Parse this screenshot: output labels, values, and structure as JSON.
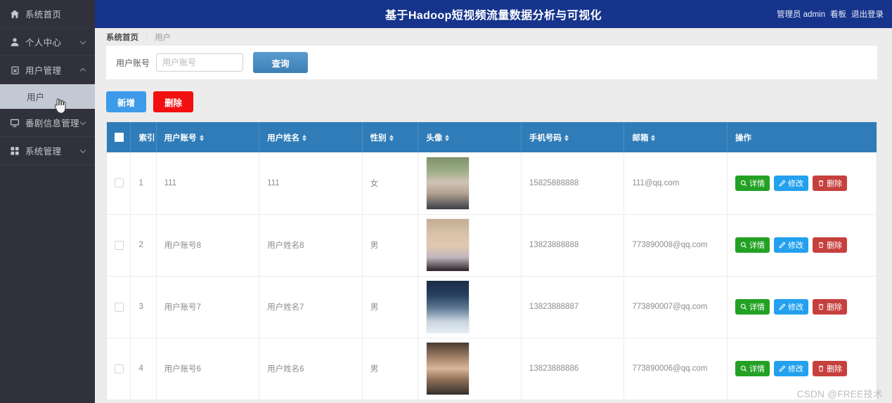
{
  "header": {
    "title": "基于Hadoop短视频流量数据分析与可视化",
    "admin_label": "管理员 admin",
    "board_label": "看板",
    "logout_label": "退出登录"
  },
  "sidebar": {
    "items": [
      {
        "label": "系统首页",
        "icon": "home-icon",
        "chevron": "none"
      },
      {
        "label": "个人中心",
        "icon": "user-icon",
        "chevron": "down"
      },
      {
        "label": "用户管理",
        "icon": "clipboard-icon",
        "chevron": "up"
      },
      {
        "label": "番剧信息管理",
        "icon": "monitor-icon",
        "chevron": "down"
      },
      {
        "label": "系统管理",
        "icon": "grid-icon",
        "chevron": "down"
      }
    ],
    "submenu": {
      "label": "用户"
    }
  },
  "breadcrumb": {
    "first": "系统首页",
    "separator": "⋮",
    "last": "用户"
  },
  "search": {
    "label": "用户账号",
    "placeholder": "用户账号",
    "value": "",
    "query_label": "查询"
  },
  "toolbar": {
    "add_label": "新增",
    "delete_label": "删除"
  },
  "table": {
    "columns": [
      {
        "key": "checkbox",
        "label": "",
        "sortable": false
      },
      {
        "key": "index",
        "label": "索引",
        "sortable": false
      },
      {
        "key": "account",
        "label": "用户账号",
        "sortable": true
      },
      {
        "key": "name",
        "label": "用户姓名",
        "sortable": true
      },
      {
        "key": "gender",
        "label": "性别",
        "sortable": true
      },
      {
        "key": "avatar",
        "label": "头像",
        "sortable": true
      },
      {
        "key": "phone",
        "label": "手机号码",
        "sortable": true
      },
      {
        "key": "email",
        "label": "邮箱",
        "sortable": true
      },
      {
        "key": "ops",
        "label": "操作",
        "sortable": false
      }
    ],
    "rows": [
      {
        "index": "1",
        "account": "111",
        "name": "111",
        "gender": "女",
        "avatar": "avatar-photo-1",
        "phone": "15825888888",
        "email": "111@qq.com"
      },
      {
        "index": "2",
        "account": "用户账号8",
        "name": "用户姓名8",
        "gender": "男",
        "avatar": "avatar-photo-2",
        "phone": "13823888888",
        "email": "773890008@qq.com"
      },
      {
        "index": "3",
        "account": "用户账号7",
        "name": "用户姓名7",
        "gender": "男",
        "avatar": "avatar-photo-3",
        "phone": "13823888887",
        "email": "773890007@qq.com"
      },
      {
        "index": "4",
        "account": "用户账号6",
        "name": "用户姓名6",
        "gender": "男",
        "avatar": "avatar-photo-4",
        "phone": "13823888886",
        "email": "773890006@qq.com"
      }
    ],
    "row_ops": {
      "detail_label": "详情",
      "edit_label": "修改",
      "delete_label": "删除"
    }
  },
  "watermark": "CSDN @FREE技术",
  "colors": {
    "topbar_bg": "#16348c",
    "sidebar_bg": "#30313a",
    "table_header_bg": "#2f7cb8",
    "submenu_active_bg": "#c3c9d4",
    "btn_add": "#3d9be9",
    "btn_delete": "#f30f0f",
    "op_detail": "#23a124",
    "op_edit": "#23a0ee",
    "op_delete": "#c6403e"
  }
}
